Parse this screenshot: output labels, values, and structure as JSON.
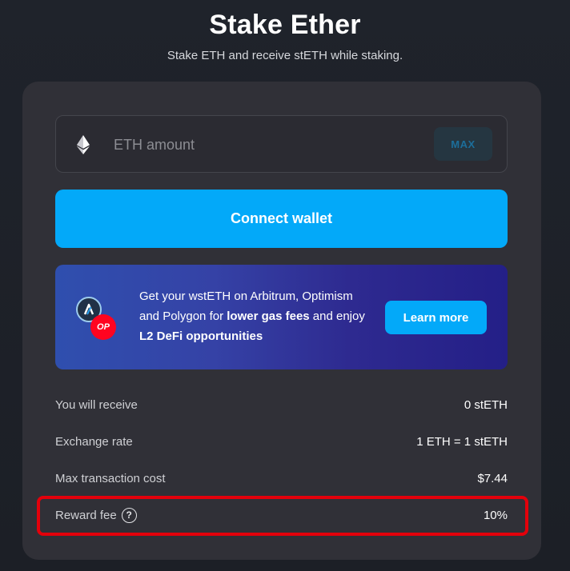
{
  "header": {
    "title": "Stake Ether",
    "subtitle": "Stake ETH and receive stETH while staking."
  },
  "stake_form": {
    "amount_placeholder": "ETH amount",
    "amount_value": "",
    "max_label": "MAX",
    "connect_label": "Connect wallet"
  },
  "banner": {
    "text_part1": "Get your wstETH on Arbitrum, Optimism and Polygon for ",
    "text_bold1": "lower gas fees",
    "text_part2": " and enjoy ",
    "text_bold2": "L2 DeFi opportunities",
    "op_badge": "OP",
    "learn_more_label": "Learn more"
  },
  "info": {
    "receive_label": "You will receive",
    "receive_value": "0 stETH",
    "rate_label": "Exchange rate",
    "rate_value": "1 ETH = 1 stETH",
    "max_cost_label": "Max transaction cost",
    "max_cost_value": "$7.44",
    "reward_fee_label": "Reward fee",
    "reward_fee_value": "10%",
    "help_glyph": "?"
  },
  "colors": {
    "accent": "#03a9f9",
    "card": "#303037",
    "background": "#1c1f26",
    "highlight": "#e3000b"
  },
  "icons": [
    "ethereum-icon",
    "arbitrum-icon",
    "optimism-icon",
    "help-icon"
  ]
}
